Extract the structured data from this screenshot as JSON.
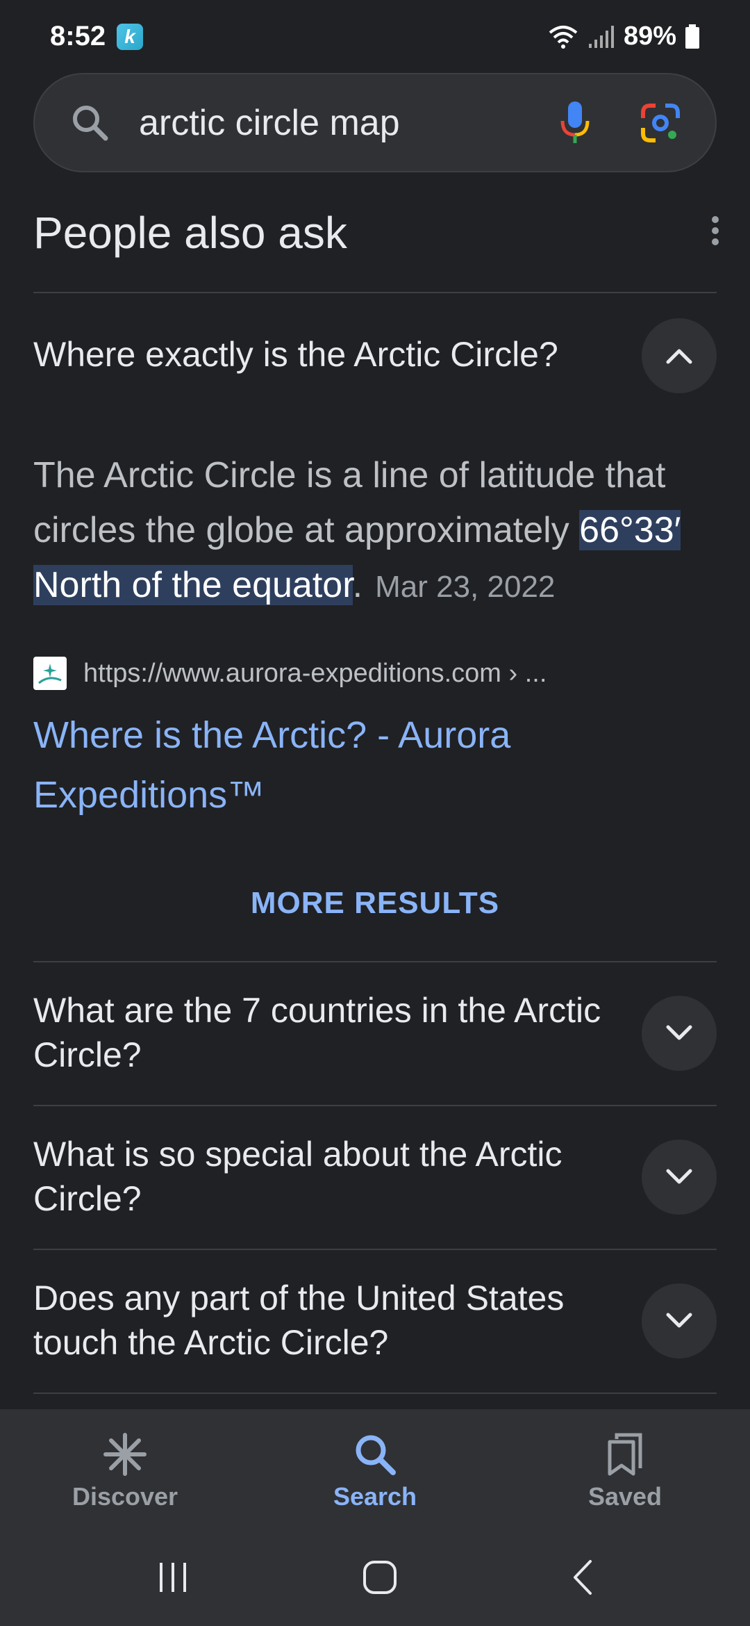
{
  "status_bar": {
    "time": "8:52",
    "app_icon_letter": "k",
    "battery": "89%"
  },
  "search": {
    "query": "arctic circle map"
  },
  "section": {
    "title": "People also ask"
  },
  "expanded_question": {
    "text": "Where exactly is the Arctic Circle?",
    "answer_prefix": "The Arctic Circle is a line of latitude that circles the globe at approximately ",
    "answer_highlight": "66°33′ North of the equator",
    "answer_suffix": ".",
    "date": "Mar 23, 2022",
    "source_url": "https://www.aurora-expeditions.com › ...",
    "source_title": "Where is the Arctic? - Aurora Expeditions™"
  },
  "more_results_label": "MORE RESULTS",
  "questions": [
    {
      "text": "What are the 7 countries in the Arctic Circle?"
    },
    {
      "text": "What is so special about the Arctic Circle?"
    },
    {
      "text": "Does any part of the United States touch the Arctic Circle?"
    }
  ],
  "bottom_nav": {
    "items": [
      {
        "label": "Discover",
        "icon": "asterisk-icon",
        "active": false
      },
      {
        "label": "Search",
        "icon": "search-icon",
        "active": true
      },
      {
        "label": "Saved",
        "icon": "bookmarks-icon",
        "active": false
      }
    ]
  },
  "colors": {
    "background": "#202124",
    "accent": "#8ab4f8",
    "highlight": "#2e3f5e"
  }
}
